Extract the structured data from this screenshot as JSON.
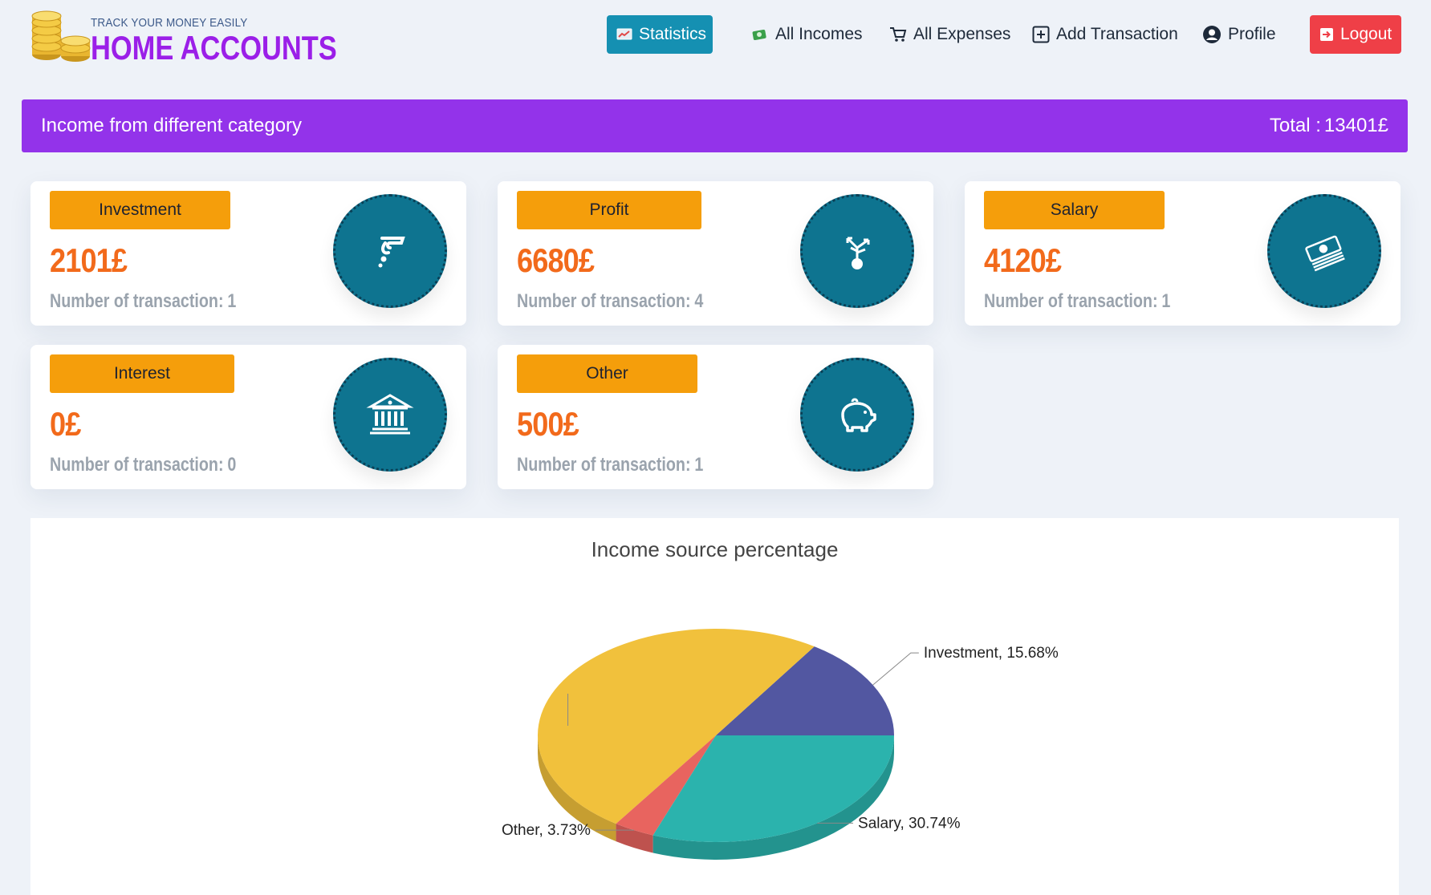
{
  "header": {
    "logo_tagline": "TRACK YOUR MONEY EASILY",
    "logo_title": "HOME ACCOUNTS",
    "nav": {
      "statistics": "Statistics",
      "all_incomes": "All Incomes",
      "all_expenses": "All Expenses",
      "add_transaction": "Add Transaction",
      "profile": "Profile",
      "logout": "Logout"
    },
    "colors": {
      "active": "#1590b2",
      "logout": "#ef3f47",
      "brand": "#9b1fe8"
    }
  },
  "banner": {
    "title": "Income from different category",
    "total_label": "Total :",
    "total_value": "13401£",
    "color": "#9333ea"
  },
  "cards": [
    {
      "label": "Investment",
      "amount": "2101£",
      "count_label": "Number of transaction:",
      "count": "1",
      "icon": "hand-coin-icon"
    },
    {
      "label": "Profit",
      "amount": "6680£",
      "count_label": "Number of transaction:",
      "count": "4",
      "icon": "growth-plant-icon"
    },
    {
      "label": "Salary",
      "amount": "4120£",
      "count_label": "Number of transaction:",
      "count": "1",
      "icon": "money-stack-icon"
    },
    {
      "label": "Interest",
      "amount": "0£",
      "count_label": "Number of transaction:",
      "count": "0",
      "icon": "bank-icon"
    },
    {
      "label": "Other",
      "amount": "500£",
      "count_label": "Number of transaction:",
      "count": "1",
      "icon": "piggy-bank-icon"
    }
  ],
  "chart_data": {
    "type": "pie",
    "title": "Income source percentage",
    "slices": [
      {
        "name": "Investment",
        "value": 15.68,
        "label": "Investment, 15.68%",
        "color": "#5257a1"
      },
      {
        "name": "Profit",
        "value": 49.85,
        "label": "",
        "color": "#f1c13c"
      },
      {
        "name": "Other",
        "value": 3.73,
        "label": "Other, 3.73%",
        "color": "#e8645f"
      },
      {
        "name": "Salary",
        "value": 30.74,
        "label": "Salary, 30.74%",
        "color": "#2bb3ad"
      }
    ]
  }
}
